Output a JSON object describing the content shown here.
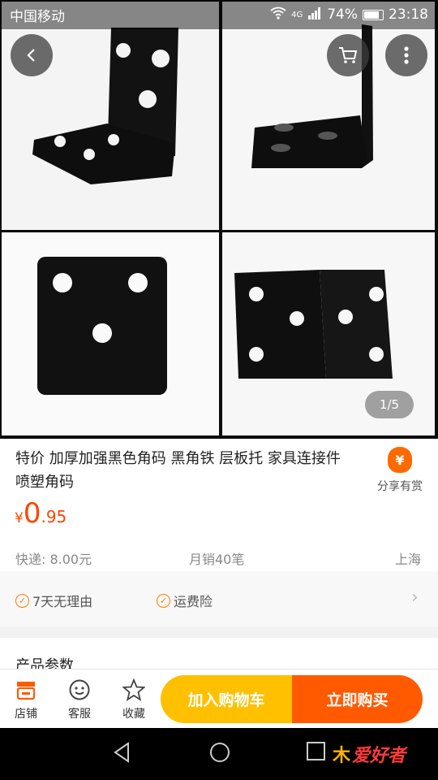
{
  "status": {
    "carrier": "中国移动",
    "network": "4G",
    "battery": "74%",
    "time": "23:18"
  },
  "gallery": {
    "pager": "1/5"
  },
  "product": {
    "title": "特价 加厚加强黑色角码 黑角铁 层板托 家具连接件 喷塑角码",
    "share_label": "分享有赏",
    "price": {
      "symbol": "¥",
      "integer": "0",
      "decimal": ".95"
    },
    "shipping": "快递: 8.00元",
    "sales": "月销40笔",
    "location": "上海"
  },
  "guarantees": [
    "7天无理由",
    "运费险"
  ],
  "params_title": "产品参数",
  "actions": {
    "store": "店铺",
    "service": "客服",
    "favorite": "收藏",
    "add_cart": "加入购物车",
    "buy_now": "立即购买"
  },
  "watermark": {
    "logo_text": "爱好者",
    "logo_mark": "木"
  },
  "icons": {
    "back": "back-chevron-icon",
    "cart": "cart-icon",
    "more": "more-vertical-icon",
    "store": "store-icon",
    "service": "customer-service-icon",
    "favorite": "star-icon"
  },
  "colors": {
    "accent": "#ff5a00",
    "cart_button": "#ffc000",
    "price": "#ff4400"
  }
}
